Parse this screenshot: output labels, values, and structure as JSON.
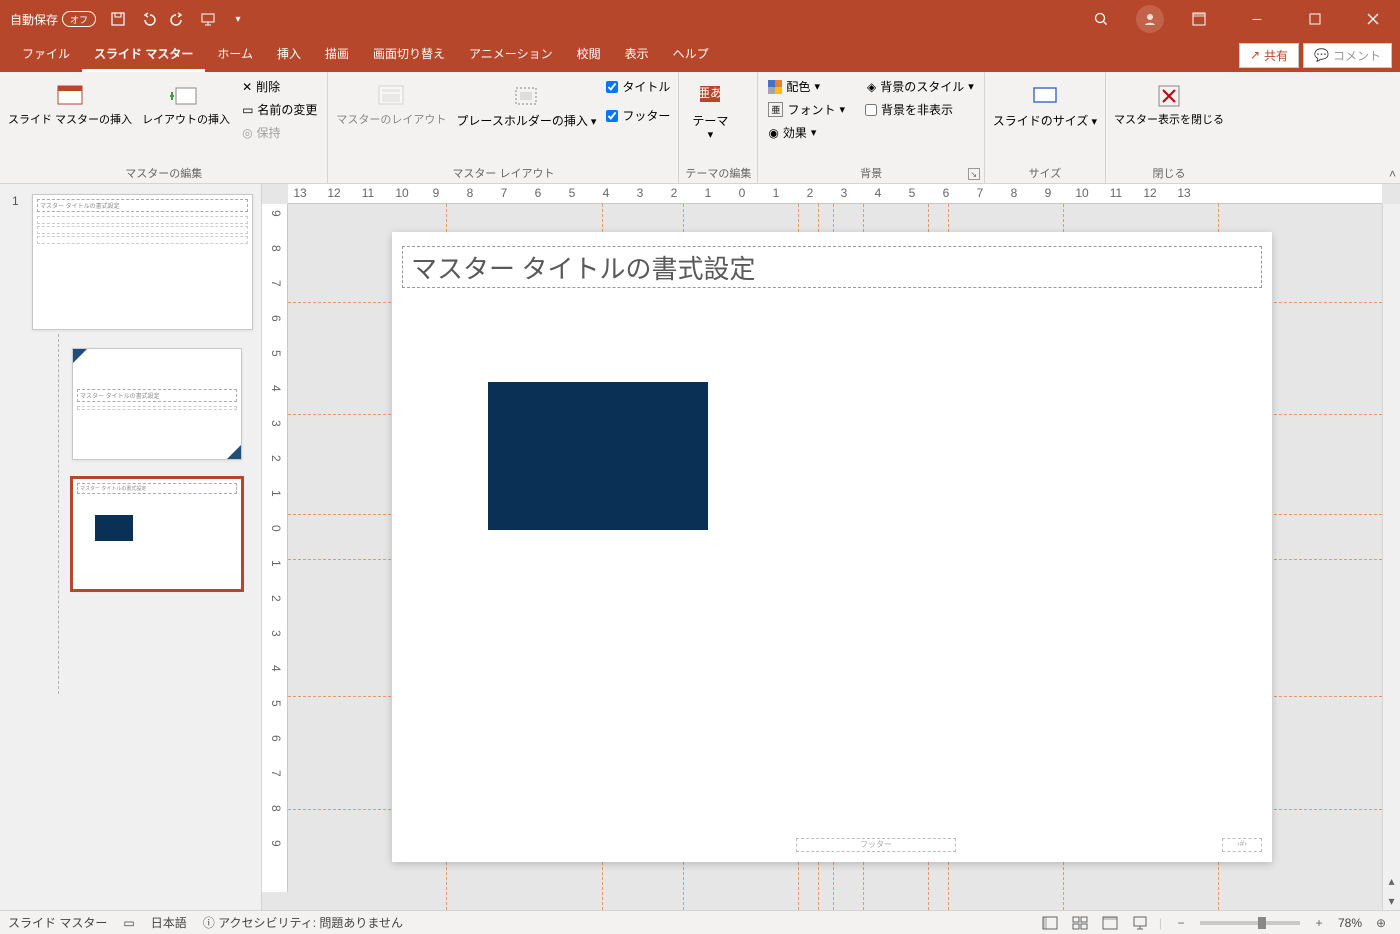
{
  "titlebar": {
    "autosave_label": "自動保存",
    "autosave_state": "オフ"
  },
  "tabs": {
    "file": "ファイル",
    "slide_master": "スライド マスター",
    "home": "ホーム",
    "insert": "挿入",
    "draw": "描画",
    "transitions": "画面切り替え",
    "animations": "アニメーション",
    "review": "校閲",
    "view": "表示",
    "help": "ヘルプ",
    "share": "共有",
    "comment": "コメント"
  },
  "ribbon": {
    "g_master_edit": "マスターの編集",
    "insert_slide_master": "スライド マスターの挿入",
    "insert_layout": "レイアウトの挿入",
    "delete": "削除",
    "rename": "名前の変更",
    "preserve": "保持",
    "g_master_layout": "マスター レイアウト",
    "master_layout": "マスターのレイアウト",
    "insert_placeholder": "プレースホルダーの挿入",
    "chk_title": "タイトル",
    "chk_footer": "フッター",
    "g_theme_edit": "テーマの編集",
    "theme": "テーマ",
    "g_background": "背景",
    "colors": "配色",
    "fonts": "フォント",
    "effects": "効果",
    "bg_styles": "背景のスタイル",
    "hide_bg": "背景を非表示",
    "g_size": "サイズ",
    "slide_size": "スライドのサイズ",
    "g_close": "閉じる",
    "close_master": "マスター表示を閉じる"
  },
  "ruler_h": [
    "13",
    "12",
    "11",
    "10",
    "9",
    "8",
    "7",
    "6",
    "5",
    "4",
    "3",
    "2",
    "1",
    "0",
    "1",
    "2",
    "3",
    "4",
    "5",
    "6",
    "7",
    "8",
    "9",
    "10",
    "11",
    "12",
    "13"
  ],
  "ruler_v": [
    "9",
    "8",
    "7",
    "6",
    "5",
    "4",
    "3",
    "2",
    "1",
    "0",
    "1",
    "2",
    "3",
    "4",
    "5",
    "6",
    "7",
    "8",
    "9"
  ],
  "slide": {
    "title": "マスター タイトルの書式設定",
    "footer": "フッター",
    "number": "‹#›"
  },
  "thumbs": {
    "n1": "1",
    "master_title": "マスター タイトルの書式設定",
    "layout_title": "マスター タイトルの書式設定"
  },
  "status": {
    "view": "スライド マスター",
    "lang": "日本語",
    "a11y": "アクセシビリティ: 問題ありません",
    "zoom": "78%"
  }
}
